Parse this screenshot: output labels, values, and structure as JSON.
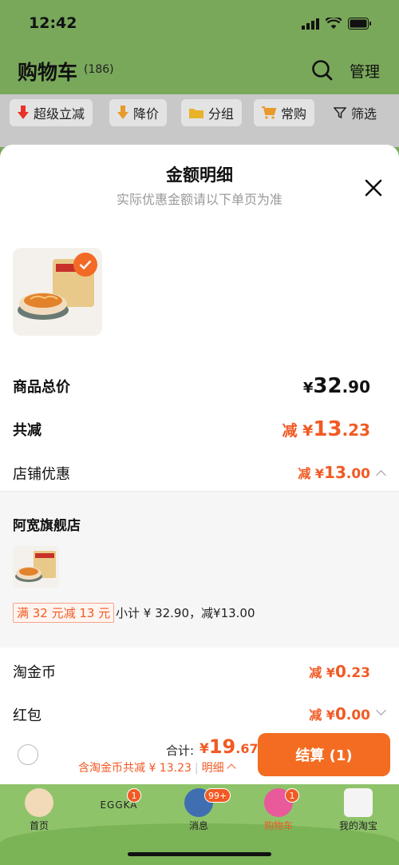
{
  "status": {
    "time": "12:42"
  },
  "header": {
    "title": "购物车",
    "count": "(186)",
    "manage": "管理"
  },
  "chips": [
    {
      "label": "超级立减",
      "icon": "arrow-down-icon",
      "color": "#e8322a"
    },
    {
      "label": "降价",
      "icon": "arrow-down-icon",
      "color": "#e89a2a"
    },
    {
      "label": "分组",
      "icon": "folder-icon",
      "color": "#e8b22a"
    },
    {
      "label": "常购",
      "icon": "cart-icon",
      "color": "#e89a2a"
    },
    {
      "label": "筛选",
      "icon": "filter-icon",
      "color": "#222222"
    }
  ],
  "sheet": {
    "title": "金额明细",
    "subtitle": "实际优惠金额请以下单页为准",
    "rows": {
      "total_label": "商品总价",
      "total_cur": "¥",
      "total_int": "32",
      "total_dec": ".90",
      "reduce_label": "共减",
      "reduce_prefix": "减 ¥",
      "reduce_int": "13",
      "reduce_dec": ".23",
      "shop_label": "店铺优惠",
      "shop_prefix": "减 ¥",
      "shop_int": "13",
      "shop_dec": ".00",
      "coin_label": "淘金币",
      "coin_prefix": "减 ¥",
      "coin_int": "0",
      "coin_dec": ".23",
      "hongbao_label": "红包",
      "hongbao_prefix": "减 ¥",
      "hongbao_int": "0",
      "hongbao_dec": ".00"
    },
    "store": {
      "name": "阿宽旗舰店",
      "promo_tag": "满 32 元减 13 元",
      "subtotal": "小计 ¥ 32.90，减¥13.00"
    }
  },
  "checkout": {
    "total_label": "合计:",
    "total_cur": "¥",
    "total_int": "19",
    "total_dec": ".67",
    "coin_note": "含淘金币共减 ¥ 13.23",
    "detail": "明细",
    "pay_label": "结算 (1)"
  },
  "tabs": [
    {
      "label": "首页",
      "badge": ""
    },
    {
      "label": "EGGKA",
      "badge": "1"
    },
    {
      "label": "消息",
      "badge": "99+"
    },
    {
      "label": "购物车",
      "badge": "1"
    },
    {
      "label": "我的淘宝",
      "badge": ""
    }
  ],
  "colors": {
    "accent": "#f15a24",
    "pay": "#f36c21",
    "header_bg": "#79a85a"
  }
}
